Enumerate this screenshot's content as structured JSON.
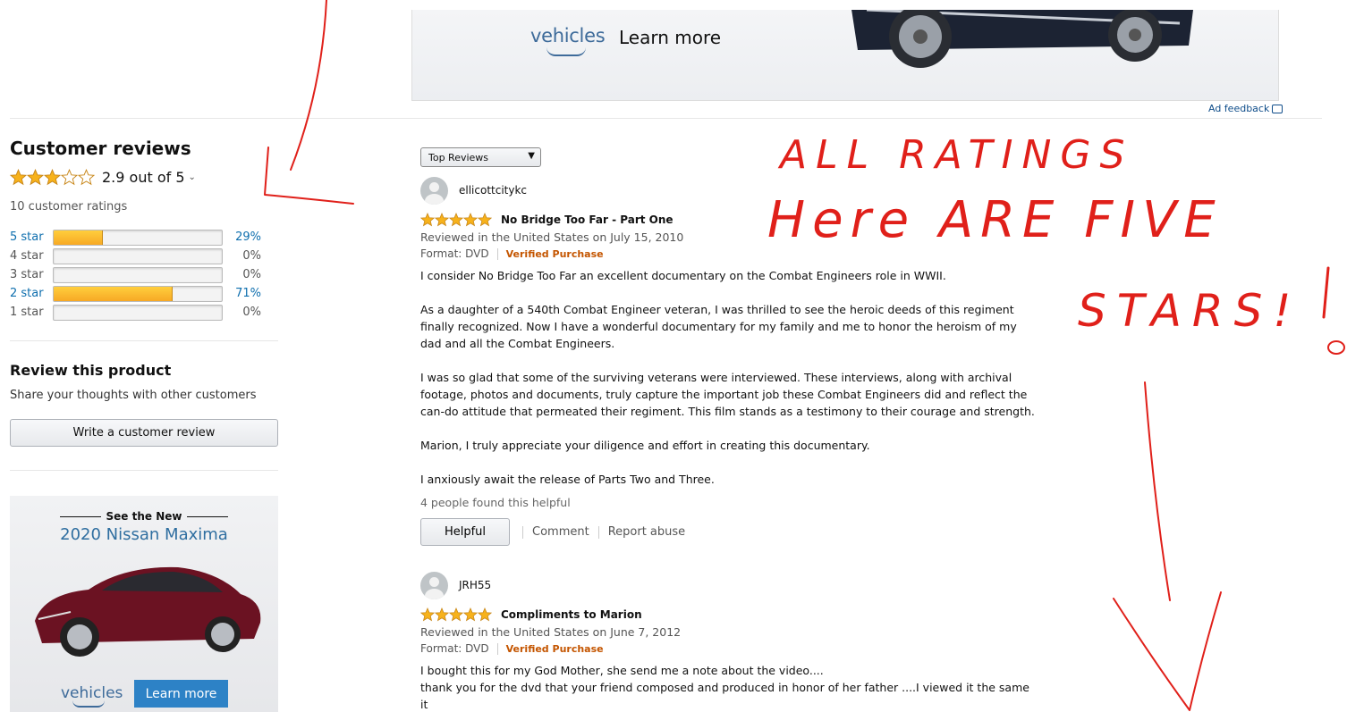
{
  "top_ad": {
    "brand": "vehicles",
    "cta": "Learn more"
  },
  "ad_feedback": "Ad feedback",
  "reviews_summary": {
    "title": "Customer reviews",
    "average_text": "2.9 out of 5",
    "average_rating": 2.9,
    "ratings_count": "10 customer ratings",
    "histogram": [
      {
        "label": "5 star",
        "pct": "29%",
        "fraction": 0.29,
        "linked": true
      },
      {
        "label": "4 star",
        "pct": "0%",
        "fraction": 0,
        "linked": false
      },
      {
        "label": "3 star",
        "pct": "0%",
        "fraction": 0,
        "linked": false
      },
      {
        "label": "2 star",
        "pct": "71%",
        "fraction": 0.71,
        "linked": true
      },
      {
        "label": "1 star",
        "pct": "0%",
        "fraction": 0,
        "linked": false
      }
    ]
  },
  "review_product": {
    "title": "Review this product",
    "subtitle": "Share your thoughts with other customers",
    "button": "Write a customer review"
  },
  "side_ad": {
    "heading": "See the New",
    "model": "2020 Nissan Maxima",
    "brand": "vehicles",
    "cta": "Learn more"
  },
  "sort": {
    "selected": "Top Reviews"
  },
  "reviews": [
    {
      "author": "ellicottcitykc",
      "rating": 5,
      "title": "No Bridge Too Far - Part One",
      "date": "Reviewed in the United States on July 15, 2010",
      "format": "Format: DVD",
      "verified": "Verified Purchase",
      "body": "I consider No Bridge Too Far an excellent documentary on the Combat Engineers role in WWII.\n\nAs a daughter of a 540th Combat Engineer veteran, I was thrilled to see the heroic deeds of this regiment finally recognized. Now I have a wonderful documentary for my family and me to honor the heroism of my dad and all the Combat Engineers.\n\nI was so glad that some of the surviving veterans were interviewed. These interviews, along with archival footage, photos and documents, truly capture the important job these Combat Engineers did and reflect the can-do attitude that permeated their regiment. This film stands as a testimony to their courage and strength.\n\nMarion, I truly appreciate your diligence and effort in creating this documentary.\n\nI anxiously await the release of Parts Two and Three.",
      "helpful_count": "4 people found this helpful",
      "helpful_btn": "Helpful",
      "comment": "Comment",
      "report": "Report abuse"
    },
    {
      "author": "JRH55",
      "rating": 5,
      "title": "Compliments to Marion",
      "date": "Reviewed in the United States on June 7, 2012",
      "format": "Format: DVD",
      "verified": "Verified Purchase",
      "body": "I bought this for my God Mother, she send me a note about the video....\nthank you for the dvd that your friend composed and produced in honor of her father ....I viewed it the same it\narrived...I found it interesting because I was aware of the subject ...the engineers did a sacrificial job throughout the"
    }
  ],
  "annotation": {
    "lines": [
      "ALL RATINGS",
      "Here ARE FIVE",
      "STARS!"
    ],
    "color": "#e0201a"
  }
}
